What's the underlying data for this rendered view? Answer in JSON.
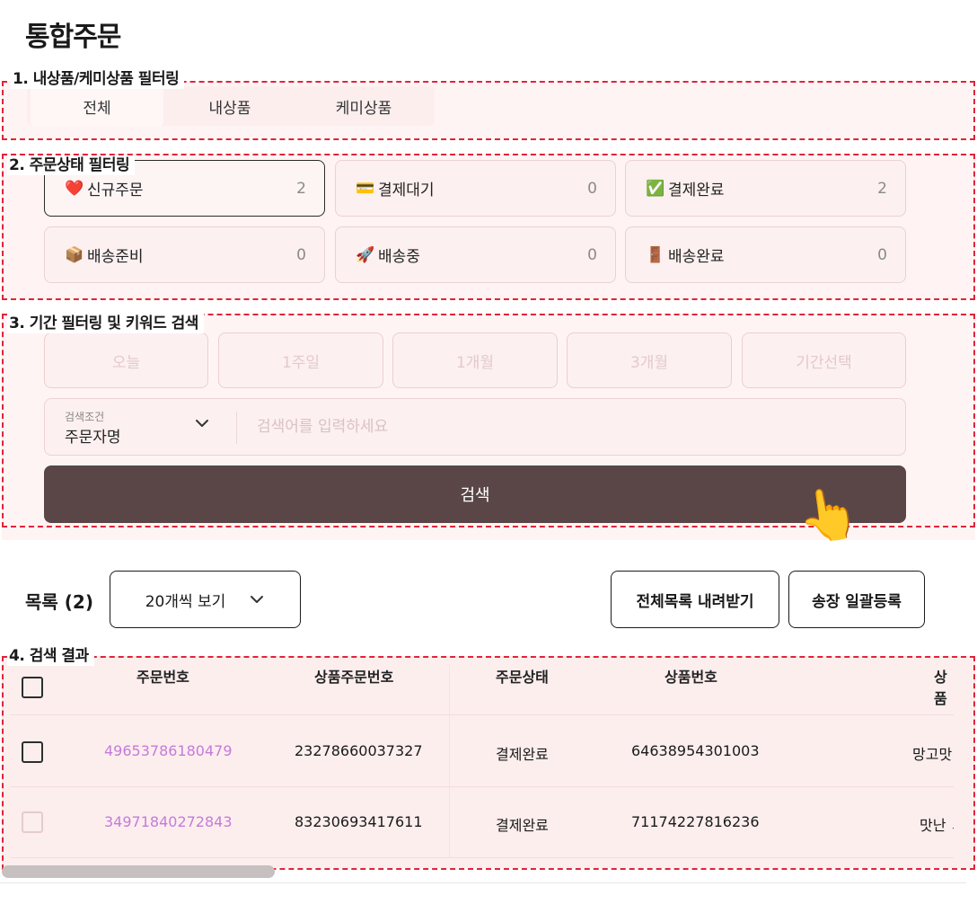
{
  "page": {
    "title": "통합주문"
  },
  "annotations": {
    "section1": "1. 내상품/케미상품 필터링",
    "section2": "2. 주문상태 필터링",
    "section3": "3. 기간 필터링 및 키워드 검색",
    "section4": "4. 검색 결과"
  },
  "product_filter": {
    "tabs": [
      {
        "label": "전체",
        "active": true
      },
      {
        "label": "내상품",
        "active": false
      },
      {
        "label": "케미상품",
        "active": false
      }
    ]
  },
  "status_filter": {
    "cards": [
      {
        "icon": "❤️",
        "icon_name": "heart-icon",
        "label": "신규주문",
        "count": "2",
        "active": true
      },
      {
        "icon": "💳",
        "icon_name": "credit-card-icon",
        "label": "결제대기",
        "count": "0",
        "active": false
      },
      {
        "icon": "✅",
        "icon_name": "check-mark-icon",
        "label": "결제완료",
        "count": "2",
        "active": false
      },
      {
        "icon": "📦",
        "icon_name": "package-icon",
        "label": "배송준비",
        "count": "0",
        "active": false
      },
      {
        "icon": "🚀",
        "icon_name": "rocket-icon",
        "label": "배송중",
        "count": "0",
        "active": false
      },
      {
        "icon": "🚪",
        "icon_name": "door-icon",
        "label": "배송완료",
        "count": "0",
        "active": false
      }
    ]
  },
  "period_filter": {
    "options": [
      "오늘",
      "1주일",
      "1개월",
      "3개월",
      "기간선택"
    ]
  },
  "search": {
    "condition_caption": "검색조건",
    "condition_value": "주문자명",
    "placeholder": "검색어를 입력하세요",
    "value": "",
    "button_label": "검색"
  },
  "pointer": {
    "icon": "👆",
    "icon_name": "pointing-hand-icon"
  },
  "list": {
    "title": "목록 (2)",
    "page_size_label": "20개씩 보기",
    "download_all_label": "전체목록 내려받기",
    "bulk_invoice_label": "송장 일괄등록"
  },
  "table": {
    "headers": [
      "주문번호",
      "상품주문번호",
      "주문상태",
      "상품번호",
      "상품"
    ],
    "rows": [
      {
        "order_no": "49653786180479",
        "product_order_no": "23278660037327",
        "status": "결제완료",
        "product_no": "64638954301003",
        "product": "망고맛"
      },
      {
        "order_no": "34971840272843",
        "product_order_no": "83230693417611",
        "status": "결제완료",
        "product_no": "71174227816236",
        "product": "맛난 ミ"
      }
    ]
  },
  "colors": {
    "accent_dark": "#5a4646",
    "annotation_red": "#e0243a",
    "link_purple": "#c47bd9",
    "section_bg": "#fdeeee"
  }
}
